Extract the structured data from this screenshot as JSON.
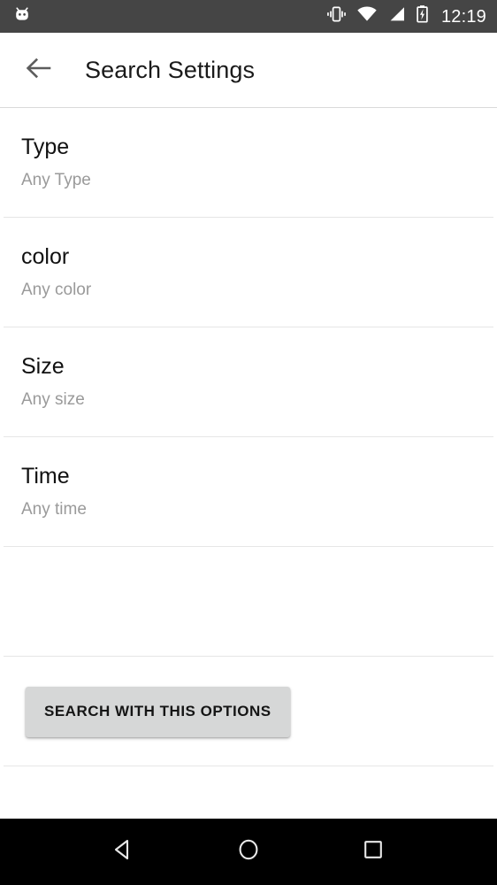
{
  "status_bar": {
    "background": "#454545",
    "notification_icon": "android-robot-icon",
    "icons": [
      "vibrate-icon",
      "wifi-icon",
      "cellular-signal-icon",
      "battery-charging-icon"
    ],
    "clock": "12:19"
  },
  "toolbar": {
    "back_icon": "back-arrow-icon",
    "title": "Search Settings"
  },
  "preferences": [
    {
      "title": "Type",
      "summary": "Any Type"
    },
    {
      "title": "color",
      "summary": "Any color"
    },
    {
      "title": "Size",
      "summary": "Any size"
    },
    {
      "title": "Time",
      "summary": "Any time"
    }
  ],
  "action": {
    "search_button_label": "SEARCH WITH THIS OPTIONS",
    "button_color": "#d6d7d7"
  },
  "nav_bar": {
    "background": "#000000",
    "back_label": "back-triangle-icon",
    "home_label": "home-circle-icon",
    "recents_label": "recents-square-icon"
  }
}
